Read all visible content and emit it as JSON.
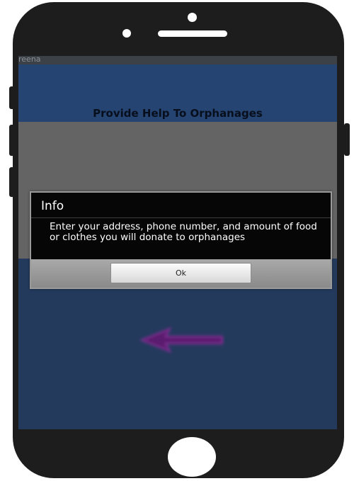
{
  "app": {
    "name": "reena"
  },
  "screen": {
    "title": "Provide Help To Orphanages"
  },
  "dialog": {
    "title": "Info",
    "message": "Enter your address, phone number, and amount of food or clothes you will donate to orphanages",
    "ok_label": "Ok"
  },
  "icons": {
    "back": "left-arrow-icon"
  },
  "colors": {
    "screen_bg": "#243a5d",
    "panel_bg": "#264471",
    "grey_block": "#646464",
    "dialog_bg": "#060606",
    "arrow": "#5a1f6e"
  }
}
